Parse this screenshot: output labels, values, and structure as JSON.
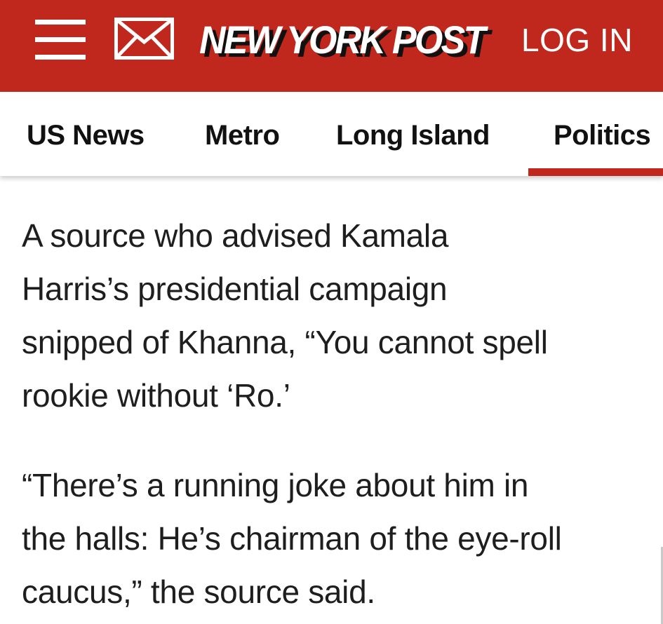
{
  "header": {
    "logo_text": "NEW YORK POST",
    "login_label": "LOG IN",
    "menu_icon": "hamburger-menu-icon",
    "mail_icon": "envelope-icon",
    "brand_red": "#c0281e"
  },
  "nav": {
    "tabs": [
      {
        "label": "US News",
        "active": false
      },
      {
        "label": "Metro",
        "active": false
      },
      {
        "label": "Long Island",
        "active": false
      },
      {
        "label": "Politics",
        "active": true
      }
    ]
  },
  "article": {
    "paragraphs": [
      {
        "lines": [
          "A source who advised Kamala",
          "Harris’s presidential campaign",
          "snipped of Khanna, “You cannot spell",
          "rookie without ‘Ro.’"
        ]
      },
      {
        "lines": [
          "“There’s a running joke about him in",
          "the halls: He’s chairman of the eye-roll",
          "caucus,” the source said."
        ]
      }
    ]
  }
}
